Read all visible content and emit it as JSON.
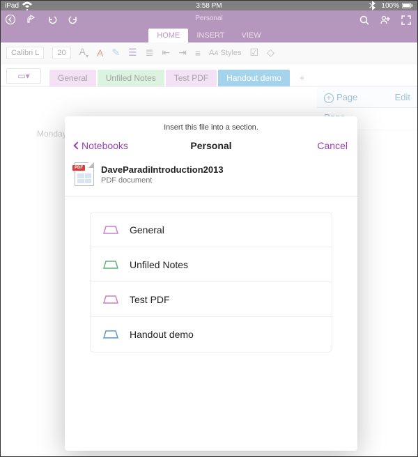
{
  "status": {
    "carrier": "iPad",
    "time": "3:58 PM",
    "battery": "100%"
  },
  "header": {
    "title": "Personal"
  },
  "ribbon": {
    "tabs": [
      "HOME",
      "INSERT",
      "VIEW"
    ],
    "active_index": 0
  },
  "format_bar": {
    "font": "Calibri L",
    "size": "20",
    "styles_label": "Styles"
  },
  "section_tabs": {
    "items": [
      {
        "label": "General"
      },
      {
        "label": "Unfiled Notes"
      },
      {
        "label": "Test PDF"
      },
      {
        "label": "Handout demo"
      }
    ]
  },
  "page_pane": {
    "add_label": "Page",
    "edit_label": "Edit",
    "items": [
      "Page"
    ]
  },
  "canvas": {
    "date_text": "Monday"
  },
  "sheet": {
    "instruction": "Insert this file into a section.",
    "back_label": "Notebooks",
    "title": "Personal",
    "cancel_label": "Cancel",
    "file": {
      "name": "DaveParadiIntroduction2013",
      "type": "PDF document"
    },
    "sections": [
      {
        "label": "General",
        "stroke": "#c97fc9"
      },
      {
        "label": "Unfiled Notes",
        "stroke": "#5fb27a"
      },
      {
        "label": "Test PDF",
        "stroke": "#c97fc9"
      },
      {
        "label": "Handout demo",
        "stroke": "#5f95c9"
      }
    ]
  }
}
